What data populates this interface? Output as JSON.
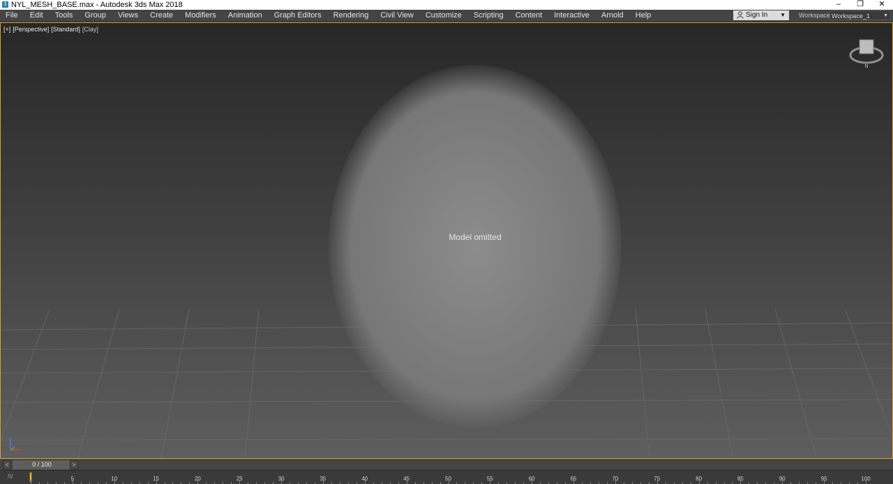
{
  "window": {
    "title": "NYL_MESH_BASE.max - Autodesk 3ds Max 2018",
    "app_icon": "3ds-max-icon",
    "controls": [
      "minimize-icon",
      "restore-icon",
      "close-icon"
    ]
  },
  "menu": [
    "File",
    "Edit",
    "Tools",
    "Group",
    "Views",
    "Create",
    "Modifiers",
    "Animation",
    "Graph Editors",
    "Rendering",
    "Civil View",
    "Customize",
    "Scripting",
    "Content",
    "Interactive",
    "Arnold",
    "Help"
  ],
  "account": {
    "sign_in_label": "Sign In",
    "user_icon": "user-icon"
  },
  "workspaces": {
    "label": "Workspaces:",
    "value": "Workspace_1"
  },
  "viewport": {
    "labels": [
      "[+]",
      "[Perspective]",
      "[Standard]",
      "[Clay]"
    ],
    "active_border_color": "#d8a033",
    "placeholder_text": "Model omitted"
  },
  "timeline": {
    "frame_readout": "0 / 100",
    "prev_label": "<",
    "next_label": ">",
    "ruler_labels": [
      "0",
      "5",
      "10",
      "15",
      "20",
      "25",
      "30",
      "35",
      "40",
      "45",
      "50",
      "55",
      "60",
      "65",
      "70",
      "75",
      "80",
      "85",
      "90",
      "95",
      "100"
    ]
  }
}
